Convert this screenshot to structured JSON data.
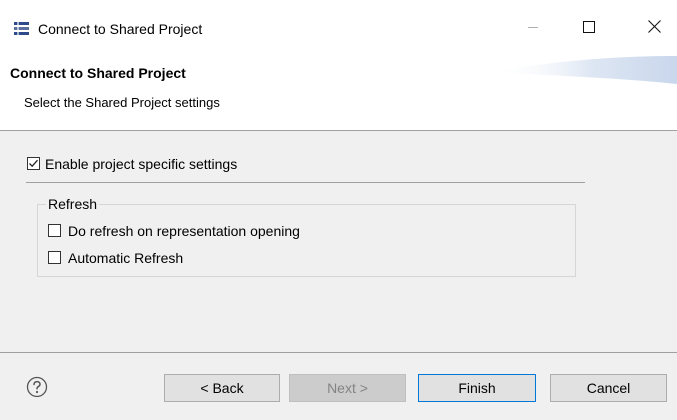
{
  "window": {
    "title": "Connect to Shared Project",
    "icon": "wizard-icon",
    "controls": {
      "minimize_icon": "minimize-icon",
      "maximize_icon": "maximize-icon",
      "close_icon": "close-icon"
    }
  },
  "header": {
    "title": "Connect to Shared Project",
    "description": "Select the Shared Project settings"
  },
  "settings": {
    "enable_label": "Enable project specific settings",
    "enable_checked": true
  },
  "refresh_group": {
    "legend": "Refresh",
    "options": [
      {
        "label": "Do refresh on representation opening",
        "checked": false
      },
      {
        "label": "Automatic Refresh",
        "checked": false
      }
    ]
  },
  "footer": {
    "help_icon": "help-icon",
    "back_label": "< Back",
    "next_label": "Next >",
    "finish_label": "Finish",
    "cancel_label": "Cancel",
    "next_enabled": false
  },
  "colors": {
    "background": "#f0f0f0",
    "header_background": "#ffffff",
    "button_background": "#e1e1e1",
    "default_button_border": "#0078d7",
    "disabled_text": "#838383"
  }
}
